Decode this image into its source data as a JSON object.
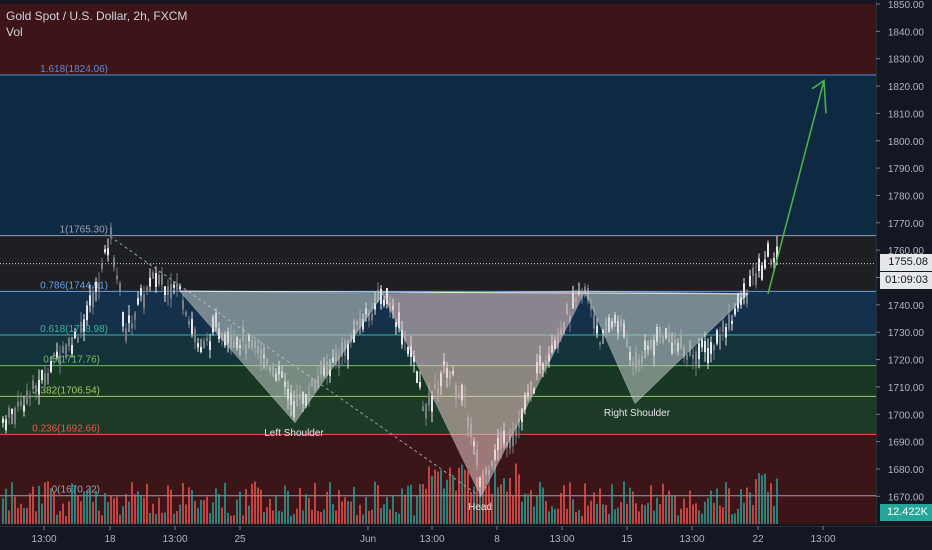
{
  "header": {
    "symbol_title": "Gold Spot / U.S. Dollar, 2h, FXCM",
    "indicator": "Vol"
  },
  "price_axis": {
    "ticks": [
      "1850.00",
      "1840.00",
      "1830.00",
      "1820.00",
      "1810.00",
      "1800.00",
      "1790.00",
      "1780.00",
      "1770.00",
      "1760.00",
      "1750.00",
      "1740.00",
      "1730.00",
      "1720.00",
      "1710.00",
      "1700.00",
      "1690.00",
      "1680.00",
      "1670.00"
    ],
    "last_price": "1755.08",
    "countdown": "01:09:03",
    "volume_tag": "12.422K"
  },
  "time_axis": {
    "labels": [
      "13:00",
      "18",
      "13:00",
      "25",
      "Jun",
      "13:00",
      "8",
      "13:00",
      "15",
      "13:00",
      "22",
      "13:00"
    ]
  },
  "fib_levels": [
    {
      "label": "1.618(1824.06)",
      "color": "#5b8bd6"
    },
    {
      "label": "1(1765.30)",
      "color": "#9aa0ac"
    },
    {
      "label": "0.786(1744.91)",
      "color": "#64a0ee"
    },
    {
      "label": "0.618(1728.98)",
      "color": "#42b39a"
    },
    {
      "label": "0.5(1717.76)",
      "color": "#6fbf63"
    },
    {
      "label": "0.382(1706.54)",
      "color": "#9ccc65"
    },
    {
      "label": "0.236(1692.66)",
      "color": "#ef5350"
    },
    {
      "label": "0(1670.22)",
      "color": "#9aa0ac"
    }
  ],
  "annotations": {
    "left_shoulder": "Left Shoulder",
    "head": "Head",
    "right_shoulder": "Right Shoulder"
  },
  "colors": {
    "background": "#131722",
    "up": "#e8e8ea",
    "down": "#7a7d85",
    "vol_up": "#26a69a",
    "vol_down": "#ef5350",
    "arrow": "#4caf50"
  }
}
